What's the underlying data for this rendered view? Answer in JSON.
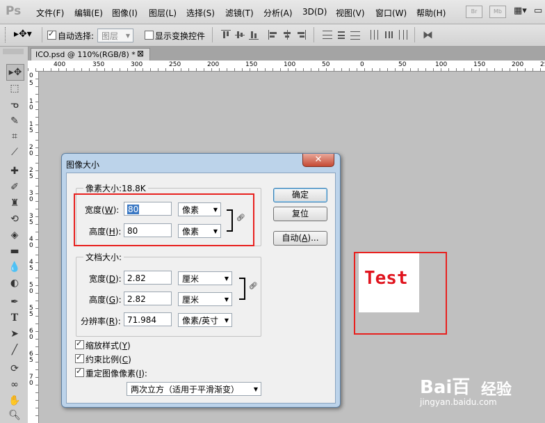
{
  "app": {
    "logo": "Ps"
  },
  "menu": [
    "文件(F)",
    "编辑(E)",
    "图像(I)",
    "图层(L)",
    "选择(S)",
    "滤镜(T)",
    "分析(A)",
    "3D(D)",
    "视图(V)",
    "窗口(W)",
    "帮助(H)"
  ],
  "menu_right": {
    "br": "Br",
    "mb": "Mb"
  },
  "options_bar": {
    "auto_select_label": "自动选择:",
    "auto_select_checked": true,
    "auto_select_value": "图层",
    "show_transform_label": "显示变换控件",
    "show_transform_checked": false
  },
  "document_tab": {
    "title": "ICO.psd @ 110%(RGB/8) *",
    "close": "⊠"
  },
  "ruler": {
    "h_labels": [
      "400",
      "350",
      "300",
      "250",
      "200",
      "150",
      "100",
      "50",
      "0",
      "50",
      "100",
      "150",
      "200",
      "25"
    ],
    "v_labels": [
      "0",
      "5",
      "1\n0",
      "1\n5",
      "2\n0",
      "2\n5",
      "3\n0",
      "3\n5",
      "4\n0",
      "4\n5",
      "5\n0",
      "5\n5",
      "6\n0",
      "6\n5",
      "7\n0"
    ]
  },
  "canvas": {
    "test_text": "Test"
  },
  "dialog": {
    "title": "图像大小",
    "close": "✕",
    "pixel_group_title": "像素大小:18.8K",
    "width_label": "宽度(",
    "width_key": "W",
    "width_suffix": "):",
    "width_value": "80",
    "width_unit": "像素",
    "height_label": "高度(",
    "height_key": "H",
    "height_suffix": "):",
    "height_value": "80",
    "height_unit": "像素",
    "doc_group_title": "文档大小:",
    "doc_width_label": "宽度(",
    "doc_width_key": "D",
    "doc_width_suffix": "):",
    "doc_width_value": "2.82",
    "doc_width_unit": "厘米",
    "doc_height_label": "高度(",
    "doc_height_key": "G",
    "doc_height_suffix": "):",
    "doc_height_value": "2.82",
    "doc_height_unit": "厘米",
    "resolution_label": "分辨率(",
    "resolution_key": "R",
    "resolution_suffix": "):",
    "resolution_value": "71.984",
    "resolution_unit": "像素/英寸",
    "scale_styles_label": "缩放样式(",
    "scale_styles_key": "Y",
    "scale_styles_suffix": ")",
    "scale_styles_checked": true,
    "constrain_label": "约束比例(",
    "constrain_key": "C",
    "constrain_suffix": ")",
    "constrain_checked": true,
    "resample_label": "重定图像像素(",
    "resample_key": "I",
    "resample_suffix": "):",
    "resample_checked": true,
    "resample_method": "两次立方（适用于平滑渐变）",
    "ok_button": "确定",
    "reset_button": "复位",
    "auto_button_prefix": "自动(",
    "auto_button_key": "A",
    "auto_button_suffix": ")..."
  },
  "watermark": {
    "logo": "Bai百",
    "brand": "经验",
    "url": "jingyan.baidu.com"
  },
  "colors": {
    "highlight_red": "#e8201e",
    "test_text": "#e0141e",
    "dialog_frame": "#bcd3ea"
  }
}
